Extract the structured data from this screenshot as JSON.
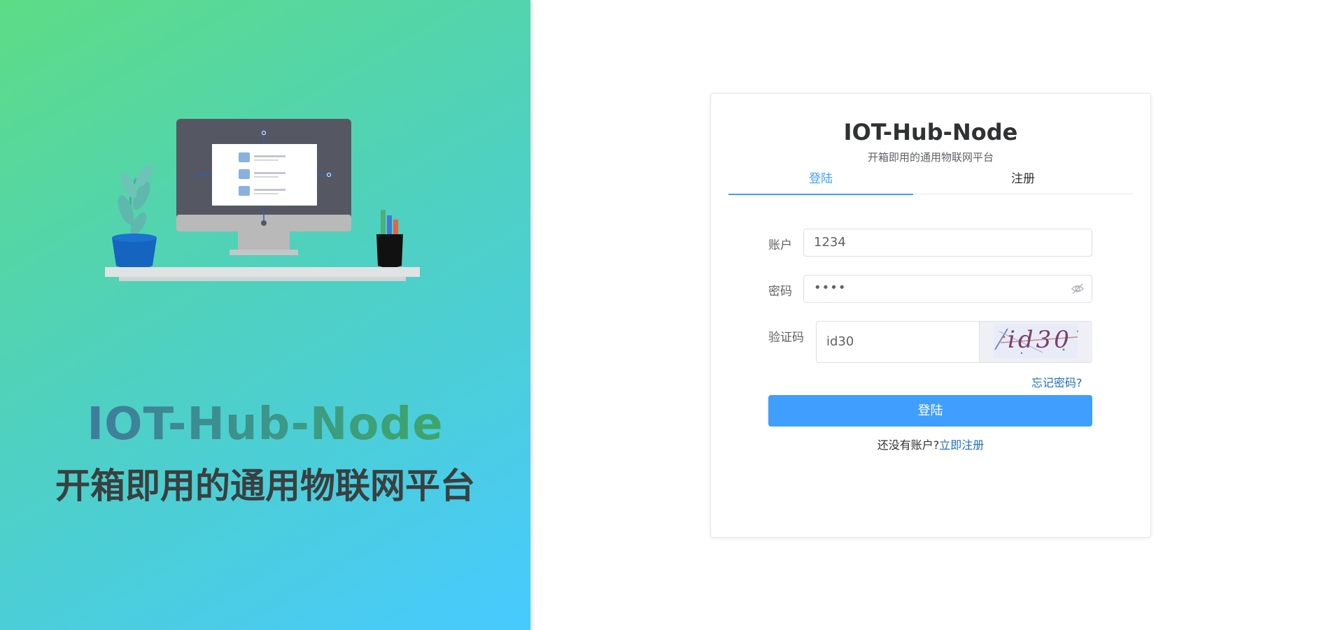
{
  "brand": {
    "title": "IOT-Hub-Node",
    "subtitle": "开箱即用的通用物联网平台"
  },
  "card": {
    "title": "IOT-Hub-Node",
    "subtitle": "开箱即用的通用物联网平台",
    "tabs": [
      {
        "label": "登陆",
        "active": true
      },
      {
        "label": "注册",
        "active": false
      }
    ]
  },
  "form": {
    "account_label": "账户",
    "account_value": "1234",
    "password_label": "密码",
    "password_value": "••••",
    "captcha_label": "验证码",
    "captcha_value": "id30",
    "captcha_image_text": "id30",
    "forgot_password": "忘记密码?",
    "login_button": "登陆",
    "no_account_text": "还没有账户?",
    "register_link": "立即注册"
  },
  "colors": {
    "primary": "#409eff",
    "link": "#1f6fbf",
    "gradient_start": "#5ddc85",
    "gradient_end": "#47caff"
  }
}
